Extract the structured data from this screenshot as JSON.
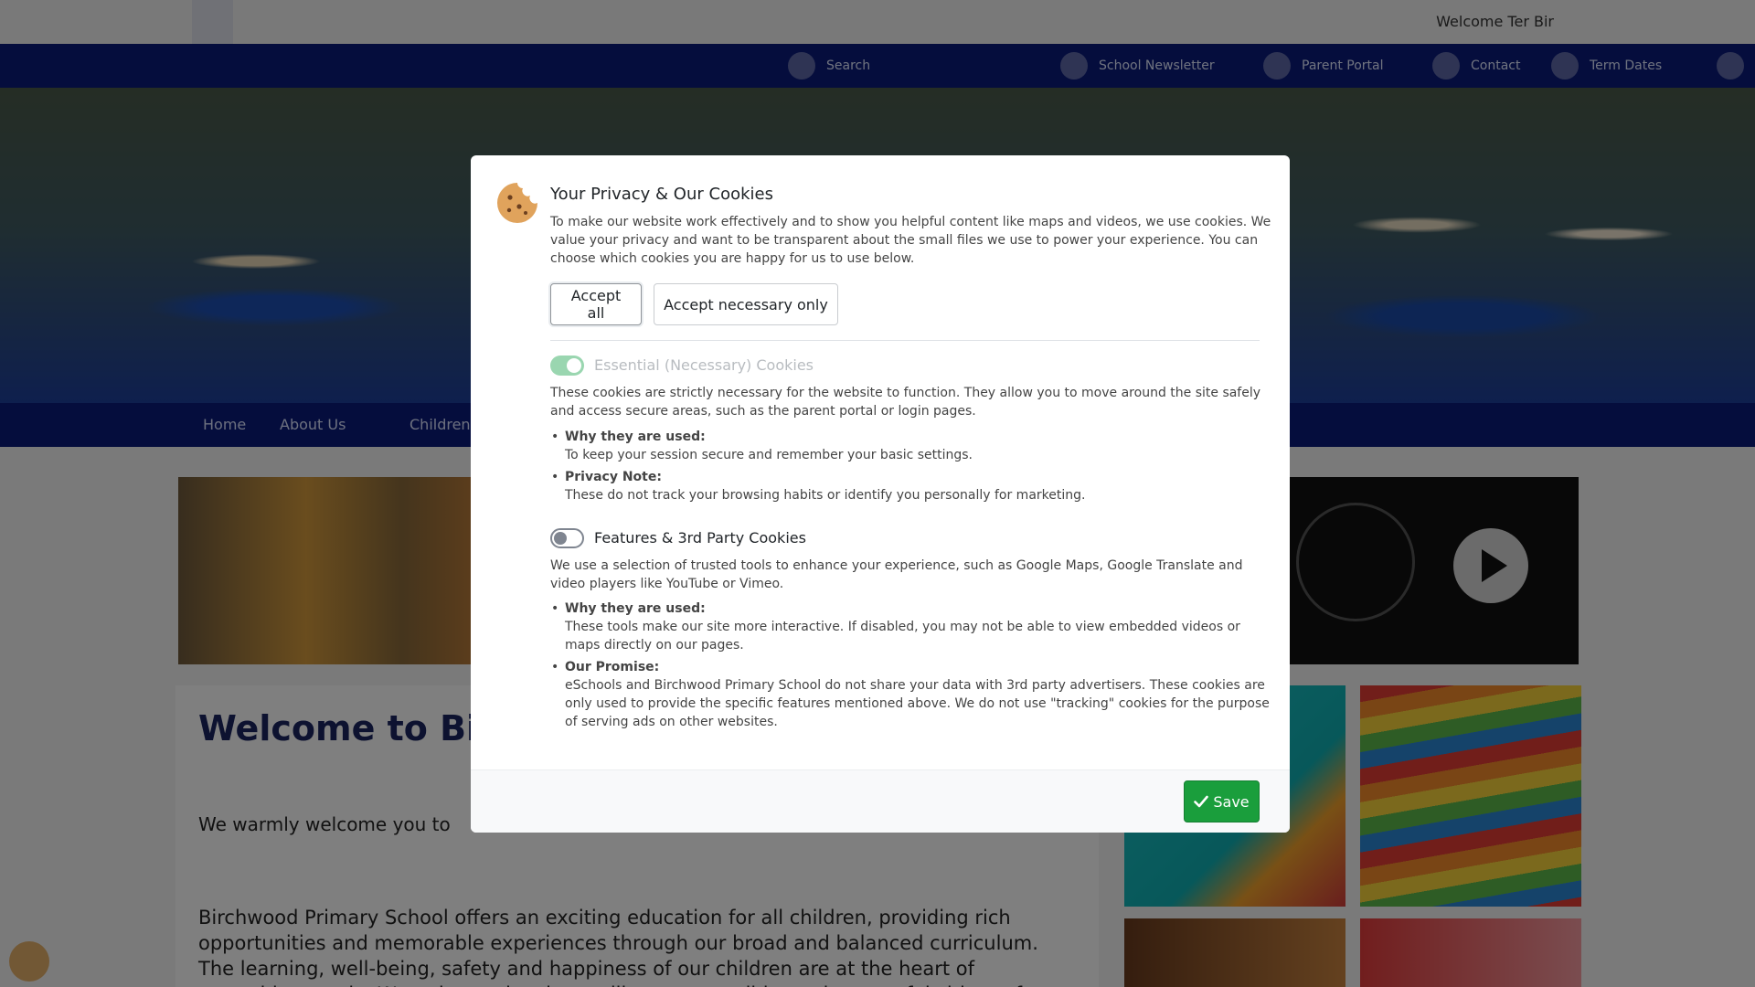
{
  "site": {
    "welcome_text": "Welcome Ter Bir",
    "quicklinks": [
      "Search",
      "School Newsletter",
      "Parent Portal",
      "Contact",
      "Term Dates",
      ""
    ],
    "nav": [
      "Home",
      "About Us",
      "Children"
    ],
    "welcome_heading": "Welcome to Bir",
    "welcome_sub": "We warmly welcome you to",
    "welcome_body": "Birchwood Primary School offers an exciting education for all children, providing rich opportunities and memorable experiences through our broad and balanced curriculum. The learning, well-being, safety and happiness of our children are at the heart of everything we do. We strive to develop resilient, responsible, and respectful citizens for the"
  },
  "modal": {
    "title": "Your Privacy & Our Cookies",
    "intro": "To make our website work effectively and to show you helpful content like maps and videos, we use cookies. We value your privacy and want to be transparent about the small files we use to power your experience. You can choose which cookies you are happy for us to use below.",
    "accept_all": "Accept all",
    "accept_necessary": "Accept necessary only",
    "essential": {
      "title": "Essential (Necessary) Cookies",
      "enabled": true,
      "disabled": true,
      "description": "These cookies are strictly necessary for the website to function. They allow you to move around the site safely and access secure areas, such as the parent portal or login pages.",
      "bullets": [
        {
          "label": "Why they are used:",
          "text": "To keep your session secure and remember your basic settings."
        },
        {
          "label": "Privacy Note:",
          "text": "These do not track your browsing habits or identify you personally for marketing."
        }
      ]
    },
    "features": {
      "title": "Features & 3rd Party Cookies",
      "enabled": false,
      "description": "We use a selection of trusted tools to enhance your experience, such as Google Maps, Google Translate and video players like YouTube or Vimeo.",
      "bullets": [
        {
          "label": "Why they are used:",
          "text": "These tools make our site more interactive. If disabled, you may not be able to view embedded videos or maps directly on our pages."
        },
        {
          "label": "Our Promise:",
          "text": "eSchools and Birchwood Primary School do not share your data with 3rd party advertisers. These cookies are only used to provide the specific features mentioned above. We do not use \"tracking\" cookies for the purpose of serving ads on other websites."
        }
      ]
    },
    "save_label": "Save"
  },
  "icons": {
    "cookie": "cookie-icon",
    "check": "check-icon"
  },
  "colors": {
    "overlay": "rgba(0,0,0,0.5)",
    "save_button": "#1a9e3c",
    "toggle_on_disabled": "#9ad6b0",
    "nav_bar": "#0a1a7a"
  }
}
